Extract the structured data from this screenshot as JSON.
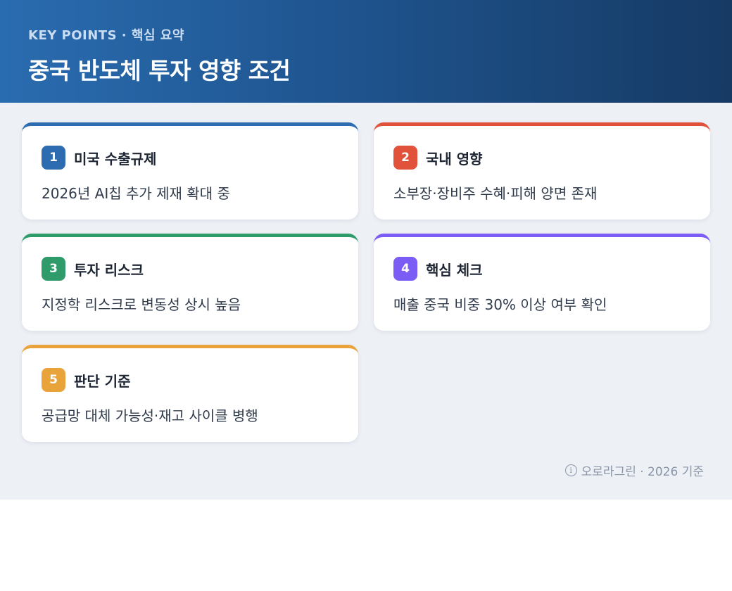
{
  "header": {
    "kicker": "KEY POINTS · 핵심 요약",
    "title": "중국 반도체 투자 영향 조건"
  },
  "cards": [
    {
      "number": "1",
      "title": "미국 수출규제",
      "body": "2026년 AI칩 추가 제재 확대 중",
      "accent": "#2d6cb0"
    },
    {
      "number": "2",
      "title": "국내 영향",
      "body": "소부장·장비주 수혜·피해 양면 존재",
      "accent": "#e0533a"
    },
    {
      "number": "3",
      "title": "투자 리스크",
      "body": "지정학 리스크로 변동성 상시 높음",
      "accent": "#2f9a6a"
    },
    {
      "number": "4",
      "title": "핵심 체크",
      "body": "매출 중국 비중 30% 이상 여부 확인",
      "accent": "#7b5cf5"
    },
    {
      "number": "5",
      "title": "판단 기준",
      "body": "공급망 대체 가능성·재고 사이클 병행",
      "accent": "#e8a43a"
    }
  ],
  "footer": {
    "icon": "info-icon",
    "text": "오로라그린 · 2026 기준"
  }
}
